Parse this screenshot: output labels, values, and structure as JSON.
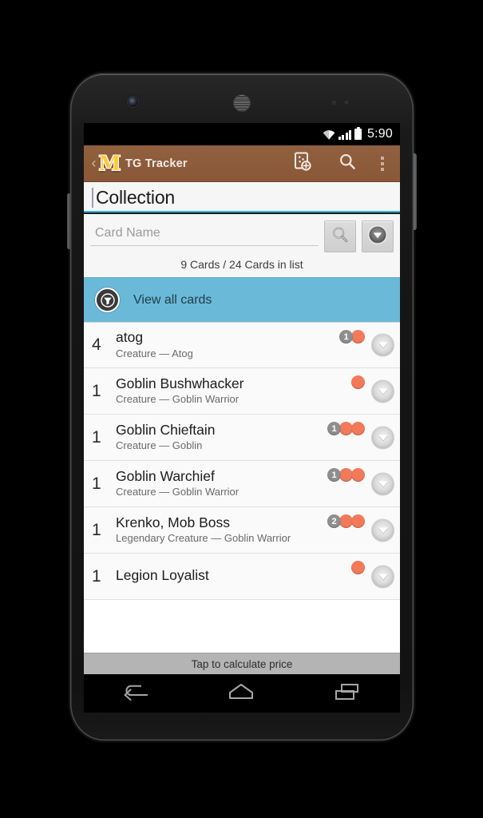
{
  "status_bar": {
    "time": "5:90",
    "icons": [
      "wifi-icon",
      "cellular-signal-icon",
      "battery-icon"
    ]
  },
  "action_bar": {
    "back_label": "‹",
    "logo_letter": "M",
    "title": "TG Tracker",
    "actions": [
      {
        "name": "add-card-icon",
        "label": "Add card"
      },
      {
        "name": "search-icon",
        "label": "Search"
      },
      {
        "name": "overflow-menu-icon",
        "label": "More options"
      }
    ],
    "background_color": "#8c5a3c"
  },
  "collection": {
    "name_value": "Collection",
    "underline_color": "#33b5e5"
  },
  "search": {
    "placeholder": "Card Name",
    "value": "",
    "search_button_label": "Search",
    "filter_button_label": "Filter"
  },
  "counts": {
    "summary": "9 Cards / 24 Cards in list"
  },
  "banner": {
    "label": "View all cards",
    "icon": "view-all-cards-icon",
    "background_color": "#6bb9d8"
  },
  "cards": [
    {
      "quantity": "4",
      "name": "atog",
      "type": "Creature  — Atog",
      "mana": [
        {
          "kind": "generic",
          "value": "1"
        },
        {
          "kind": "red",
          "value": ""
        }
      ]
    },
    {
      "quantity": "1",
      "name": "Goblin Bushwhacker",
      "type": "Creature  — Goblin Warrior",
      "mana": [
        {
          "kind": "red",
          "value": ""
        }
      ]
    },
    {
      "quantity": "1",
      "name": "Goblin Chieftain",
      "type": "Creature  — Goblin",
      "mana": [
        {
          "kind": "generic",
          "value": "1"
        },
        {
          "kind": "red",
          "value": ""
        },
        {
          "kind": "red",
          "value": ""
        }
      ]
    },
    {
      "quantity": "1",
      "name": "Goblin Warchief",
      "type": "Creature — Goblin Warrior",
      "mana": [
        {
          "kind": "generic",
          "value": "1"
        },
        {
          "kind": "red",
          "value": ""
        },
        {
          "kind": "red",
          "value": ""
        }
      ]
    },
    {
      "quantity": "1",
      "name": "Krenko, Mob Boss",
      "type": "Legendary Creature — Goblin Warrior",
      "mana": [
        {
          "kind": "generic",
          "value": "2"
        },
        {
          "kind": "red",
          "value": ""
        },
        {
          "kind": "red",
          "value": ""
        }
      ]
    },
    {
      "quantity": "1",
      "name": "Legion Loyalist",
      "type": "",
      "mana": [
        {
          "kind": "red",
          "value": ""
        }
      ]
    }
  ],
  "price_bar": {
    "label": "Tap to calculate price"
  },
  "nav_bar": {
    "buttons": [
      {
        "name": "back-nav-icon",
        "label": "Back"
      },
      {
        "name": "home-nav-icon",
        "label": "Home"
      },
      {
        "name": "recents-nav-icon",
        "label": "Recent apps"
      }
    ]
  },
  "colors": {
    "accent_blue": "#33b5e5",
    "banner_blue": "#6bb9d8",
    "brand_brown": "#8c5a3c",
    "mana_red": "#f2795a",
    "mana_generic": "#8e8e8e"
  }
}
